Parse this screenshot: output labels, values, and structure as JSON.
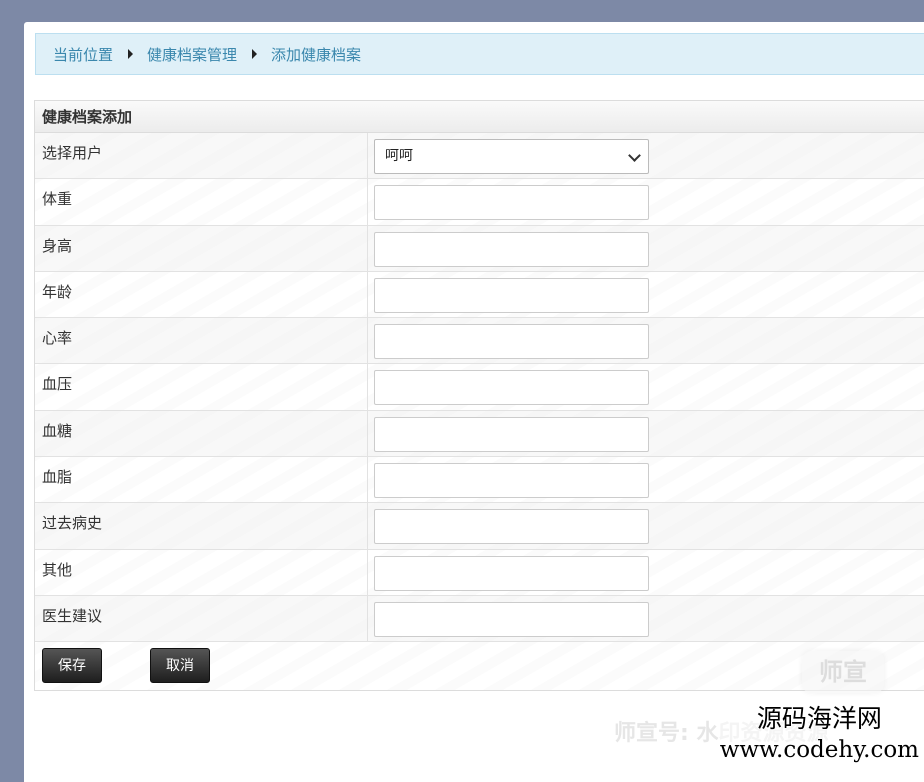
{
  "breadcrumb": {
    "items": [
      "当前位置",
      "健康档案管理",
      "添加健康档案"
    ]
  },
  "form": {
    "title": "健康档案添加",
    "user_select": {
      "label": "选择用户",
      "value": "呵呵"
    },
    "fields": [
      {
        "label": "体重",
        "value": ""
      },
      {
        "label": "身高",
        "value": ""
      },
      {
        "label": "年龄",
        "value": ""
      },
      {
        "label": "心率",
        "value": ""
      },
      {
        "label": "血压",
        "value": ""
      },
      {
        "label": "血糖",
        "value": ""
      },
      {
        "label": "血脂",
        "value": ""
      },
      {
        "label": "过去病史",
        "value": ""
      },
      {
        "label": "其他",
        "value": ""
      },
      {
        "label": "医生建议",
        "value": ""
      }
    ],
    "buttons": {
      "save": "保存",
      "cancel": "取消"
    }
  },
  "watermark": {
    "logo_text": "师宣",
    "caption": "师宣号: 水印资源资源"
  },
  "brand": {
    "name": "源码海洋网",
    "url": "www.codehy.com"
  },
  "colors": {
    "page_background": "#7d89a6",
    "breadcrumb_background": "#dff0f8",
    "breadcrumb_text": "#3a87ad",
    "button_background": "#2a2a2a"
  },
  "icons": {
    "breadcrumb_separator": "caret-right-icon",
    "select_arrow": "chevron-down-icon"
  }
}
